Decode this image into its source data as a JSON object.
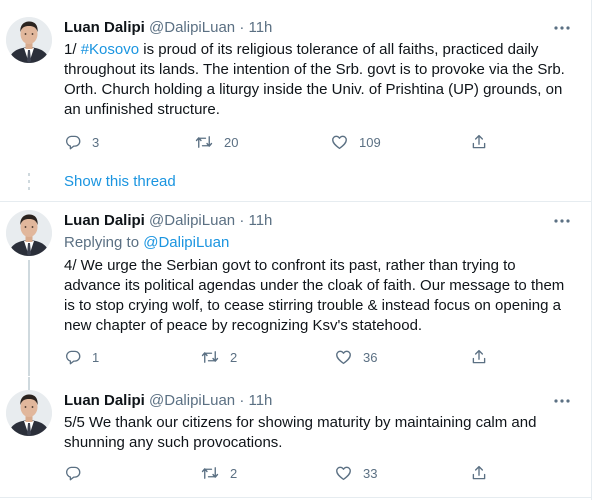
{
  "tweets": [
    {
      "name": "Luan Dalipi",
      "handle": "@DalipiLuan",
      "sep": "·",
      "time": "11h",
      "prefix": "1/ ",
      "hashtag": "#Kosovo",
      "body_lines": [
        " is proud of its religious tolerance of all faiths, practiced daily",
        "throughout its lands. The intention of the Srb. govt is to provoke via the Srb.",
        "Orth. Church holding a liturgy inside the Univ. of Prishtina (UP) grounds, on",
        "an unfinished structure."
      ],
      "replies": "3",
      "retweets": "20",
      "likes": "109"
    },
    {
      "name": "Luan Dalipi",
      "handle": "@DalipiLuan",
      "sep": "·",
      "time": "11h",
      "replying_label": "Replying to",
      "replying_handle": "@DalipiLuan",
      "body_lines": [
        "4/ We urge the Serbian govt to confront its past, rather than trying to",
        "advance its political agendas under the cloak of faith. Our message to them",
        "is to stop crying wolf, to cease stirring trouble & instead focus on opening a",
        "new chapter of peace by recognizing Ksv's statehood."
      ],
      "replies": "1",
      "retweets": "2",
      "likes": "36"
    },
    {
      "name": "Luan Dalipi",
      "handle": "@DalipiLuan",
      "sep": "·",
      "time": "11h",
      "body_lines": [
        "5/5 We thank our citizens for showing maturity by maintaining calm and",
        "shunning any such provocations."
      ],
      "replies": "",
      "retweets": "2",
      "likes": "33"
    }
  ],
  "show_thread": "Show this thread",
  "icons": {
    "reply": "reply-icon",
    "retweet": "retweet-icon",
    "like": "heart-icon",
    "share": "share-icon",
    "more": "more-icon"
  },
  "colors": {
    "accent": "#1b95e0",
    "muted": "#5b7083",
    "text": "#0f1419",
    "divider": "#e6ecf0"
  }
}
